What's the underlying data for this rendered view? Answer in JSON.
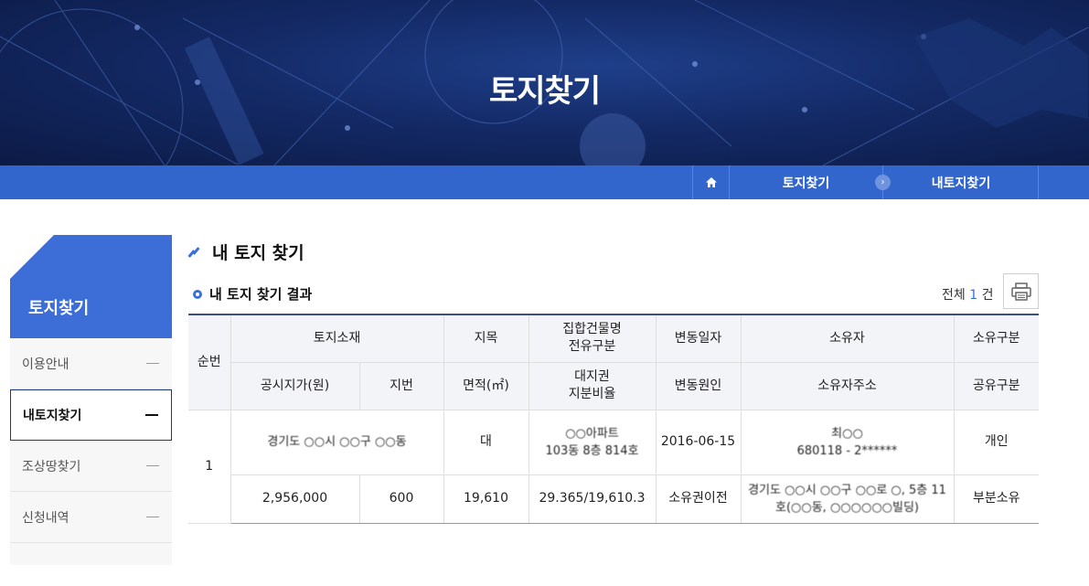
{
  "banner": {
    "title": "토지찾기"
  },
  "breadcrumb": {
    "home_icon": "home-icon",
    "level1": "토지찾기",
    "level2": "내토지찾기"
  },
  "sidebar": {
    "title": "토지찾기",
    "items": [
      {
        "label": "이용안내",
        "active": false
      },
      {
        "label": "내토지찾기",
        "active": true
      },
      {
        "label": "조상땅찾기",
        "active": false
      },
      {
        "label": "신청내역",
        "active": false
      }
    ]
  },
  "main": {
    "page_title": "내 토지 찾기",
    "section_title": "내 토지 찾기 결과",
    "total_prefix": "전체",
    "total_count": "1",
    "total_suffix": "건",
    "print_icon": "printer-icon"
  },
  "table": {
    "headers": {
      "seq": "순번",
      "location": "토지소재",
      "jimok": "지목",
      "building_1": "집합건물명",
      "building_2": "전유구분",
      "change_date": "변동일자",
      "owner": "소유자",
      "ownership_type": "소유구분",
      "price": "공시지가(원)",
      "lot_no": "지번",
      "area": "면적(㎡)",
      "land_right_1": "대지권",
      "land_right_2": "지분비율",
      "change_reason": "변동원인",
      "owner_address": "소유자주소",
      "share_type": "공유구분"
    },
    "rows": [
      {
        "seq": "1",
        "location": "경기도 ○○시 ○○구 ○○동",
        "jimok": "대",
        "building_line1": "○○아파트",
        "building_line2": "103동 8층 814호",
        "change_date": "2016-06-15",
        "owner_line1": "최○○",
        "owner_line2": "680118 - 2******",
        "ownership_type": "개인",
        "price": "2,956,000",
        "lot_no": "600",
        "area": "19,610",
        "land_right": "29.365/19,610.3",
        "change_reason": "소유권이전",
        "owner_address_line1": "경기도 ○○시 ○○구 ○○로 ○, 5층 11",
        "owner_address_line2": "호(○○동, ○○○○○○빌딩)",
        "share_type": "부분소유"
      }
    ]
  }
}
